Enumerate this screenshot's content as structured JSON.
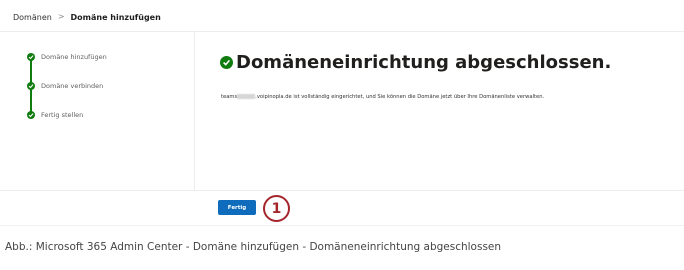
{
  "breadcrumb": {
    "parent": "Domänen",
    "separator": ">",
    "current": "Domäne hinzufügen"
  },
  "steps": [
    {
      "label": "Domäne hinzufügen",
      "status": "completed"
    },
    {
      "label": "Domäne verbinden",
      "status": "completed"
    },
    {
      "label": "Fertig stellen",
      "status": "completed"
    }
  ],
  "main": {
    "title": "Domäneneinrichtung abgeschlossen.",
    "info_prefix": "teams",
    "info_suffix": ".voipinopla.de ist vollständig eingerichtet, und Sie können die Domäne jetzt über Ihre Domänenliste verwalten."
  },
  "footer": {
    "finish_label": "Fertig"
  },
  "callout": {
    "number": "1"
  },
  "caption": "Abb.: Microsoft 365 Admin Center - Domäne hinzufügen - Domäneneinrichtung abgeschlossen",
  "colors": {
    "success": "#107c10",
    "primary": "#0f6cbd",
    "callout": "#a4262c"
  },
  "icons": {
    "step": "checkmark-circle-icon",
    "heading": "checkmark-circle-icon",
    "breadcrumb_separator": "chevron-right-icon"
  }
}
